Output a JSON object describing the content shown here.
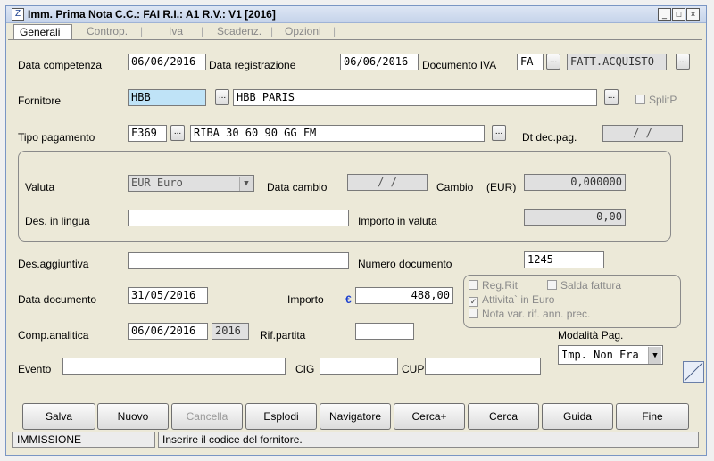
{
  "window": {
    "title": "Imm. Prima Nota C.C.: FAI  R.I.: A1  R.V.: V1  [2016]",
    "controls": {
      "minimize": "_",
      "maximize": "□",
      "close": "×"
    }
  },
  "tabs": [
    "Generali",
    "Controp.",
    "Iva",
    "Scadenz.",
    "Opzioni"
  ],
  "form": {
    "data_competenza_label": "Data competenza",
    "data_competenza": "06/06/2016",
    "data_registrazione_label": "Data registrazione",
    "data_registrazione": "06/06/2016",
    "documento_iva_label": "Documento IVA",
    "documento_iva_code": "FA",
    "documento_iva_desc": "FATT.ACQUISTO",
    "fornitore_label": "Fornitore",
    "fornitore_code": "HBB",
    "fornitore_name": "HBB PARIS",
    "splitp_label": "SplitP",
    "tipo_pagamento_label": "Tipo pagamento",
    "tipo_pagamento_code": "F369",
    "tipo_pagamento_desc": "RIBA 30 60 90 GG FM",
    "dt_dec_pag_label": "Dt dec.pag.",
    "dt_dec_pag": "/ /",
    "valuta_label": "Valuta",
    "valuta": "EUR Euro",
    "data_cambio_label": "Data cambio",
    "data_cambio": "/ /",
    "cambio_label": "Cambio",
    "cambio_unit": "(EUR)",
    "cambio": "0,000000",
    "des_lingua_label": "Des. in lingua",
    "des_lingua": "",
    "importo_valuta_label": "Importo in valuta",
    "importo_valuta": "0,00",
    "des_aggiuntiva_label": "Des.aggiuntiva",
    "des_aggiuntiva": "",
    "numero_documento_label": "Numero documento",
    "numero_documento": "1245",
    "data_documento_label": "Data documento",
    "data_documento": "31/05/2016",
    "importo_label": "Importo",
    "importo_currency": "€",
    "importo": "488,00",
    "reg_rit_label": "Reg.Rit",
    "saldo_fattura_label": "Salda fattura",
    "attivita_euro_label": "Attivita` in Euro",
    "nota_var_label": "Nota var. rif. ann. prec.",
    "comp_analitica_label": "Comp.analitica",
    "comp_analitica": "06/06/2016",
    "comp_analitica_year": "2016",
    "rif_partita_label": "Rif.partita",
    "rif_partita": "",
    "modalita_pag_label": "Modalità Pag.",
    "modalita_pag": "Imp. Non Fra",
    "evento_label": "Evento",
    "evento": "",
    "cig_label": "CIG",
    "cig": "",
    "cup_label": "CUP",
    "cup": ""
  },
  "buttons": {
    "salva": "Salva",
    "nuovo": "Nuovo",
    "cancella": "Cancella",
    "esplodi": "Esplodi",
    "navigatore": "Navigatore",
    "cerca_plus": "Cerca+",
    "cerca": "Cerca",
    "guida": "Guida",
    "fine": "Fine"
  },
  "status": {
    "mode": "IMMISSIONE",
    "message": "Inserire il codice del fornitore."
  },
  "dots_label": "...",
  "colors": {
    "highlight_field": "#bfe3f7",
    "euro_sign": "#1a3fcf"
  }
}
